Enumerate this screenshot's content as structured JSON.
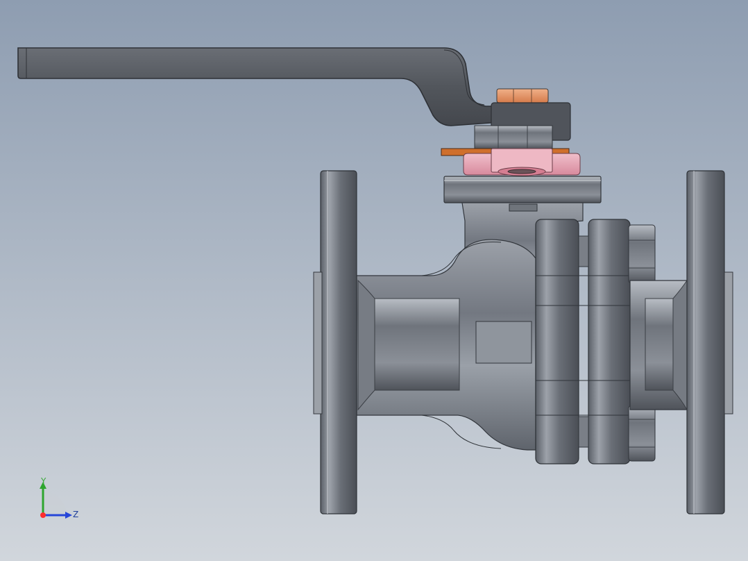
{
  "viewport": {
    "background_top": "#8e9db1",
    "background_bottom": "#d1d6dc"
  },
  "model": {
    "handle_color": "#4f5359",
    "body_color": "#8f949c",
    "accent_orange": "#e8a06c",
    "accent_pink": "#e8a7b6",
    "steel_dark": "#595e66"
  },
  "triad": {
    "x_axis_color": "#ff2d2d",
    "y_axis_color": "#2ea52e",
    "z_axis_color": "#2646d8",
    "y_label": "Y",
    "z_label": "Z"
  }
}
